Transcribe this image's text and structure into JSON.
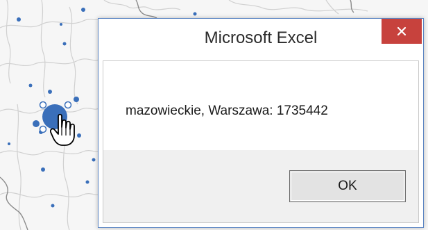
{
  "dialog": {
    "title": "Microsoft Excel",
    "message": "mazowieckie, Warszawa: 1735442",
    "ok_label": "OK",
    "close_glyph": "×"
  },
  "icons": {
    "close": "close-icon",
    "cursor": "hand-pointer-icon"
  },
  "colors": {
    "close_button": "#c7423d",
    "dialog_border": "#5a84c2",
    "map_point": "#3a6fba"
  }
}
